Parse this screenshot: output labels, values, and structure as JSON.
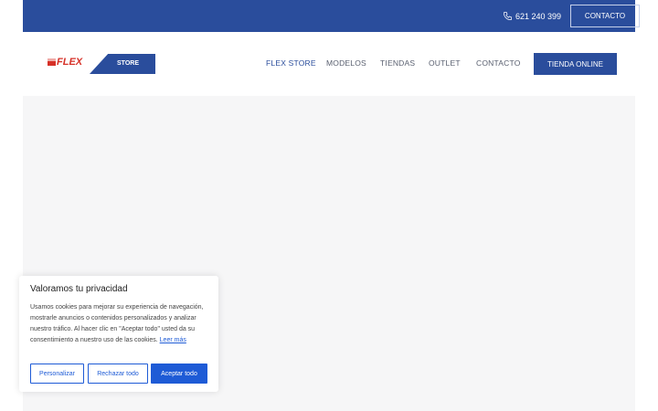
{
  "topbar": {
    "phone": "621 240 399",
    "contact_label": "CONTACTO"
  },
  "logo": {
    "brand": "FLEX",
    "suffix": "STORE"
  },
  "nav": {
    "items": [
      {
        "label": "FLEX STORE"
      },
      {
        "label": "MODELOS"
      },
      {
        "label": "TIENDAS"
      },
      {
        "label": "OUTLET"
      },
      {
        "label": "CONTACTO"
      }
    ],
    "cta_label": "TIENDA ONLINE"
  },
  "cookie": {
    "title": "Valoramos tu privacidad",
    "text": "Usamos cookies para mejorar su experiencia de navegación, mostrarle anuncios o contenidos personalizados y analizar nuestro tráfico. Al hacer clic en \"Aceptar todo\" usted da su consentimiento a nuestro uso de las cookies.",
    "link_label": "Leer más",
    "customize_label": "Personalizar",
    "reject_label": "Rechazar todo",
    "accept_label": "Aceptar todo"
  },
  "colors": {
    "brand_blue": "#2a4d9c",
    "accent_blue": "#1e5bd6",
    "logo_red": "#d63027"
  },
  "icons": {
    "phone": "phone-icon"
  }
}
